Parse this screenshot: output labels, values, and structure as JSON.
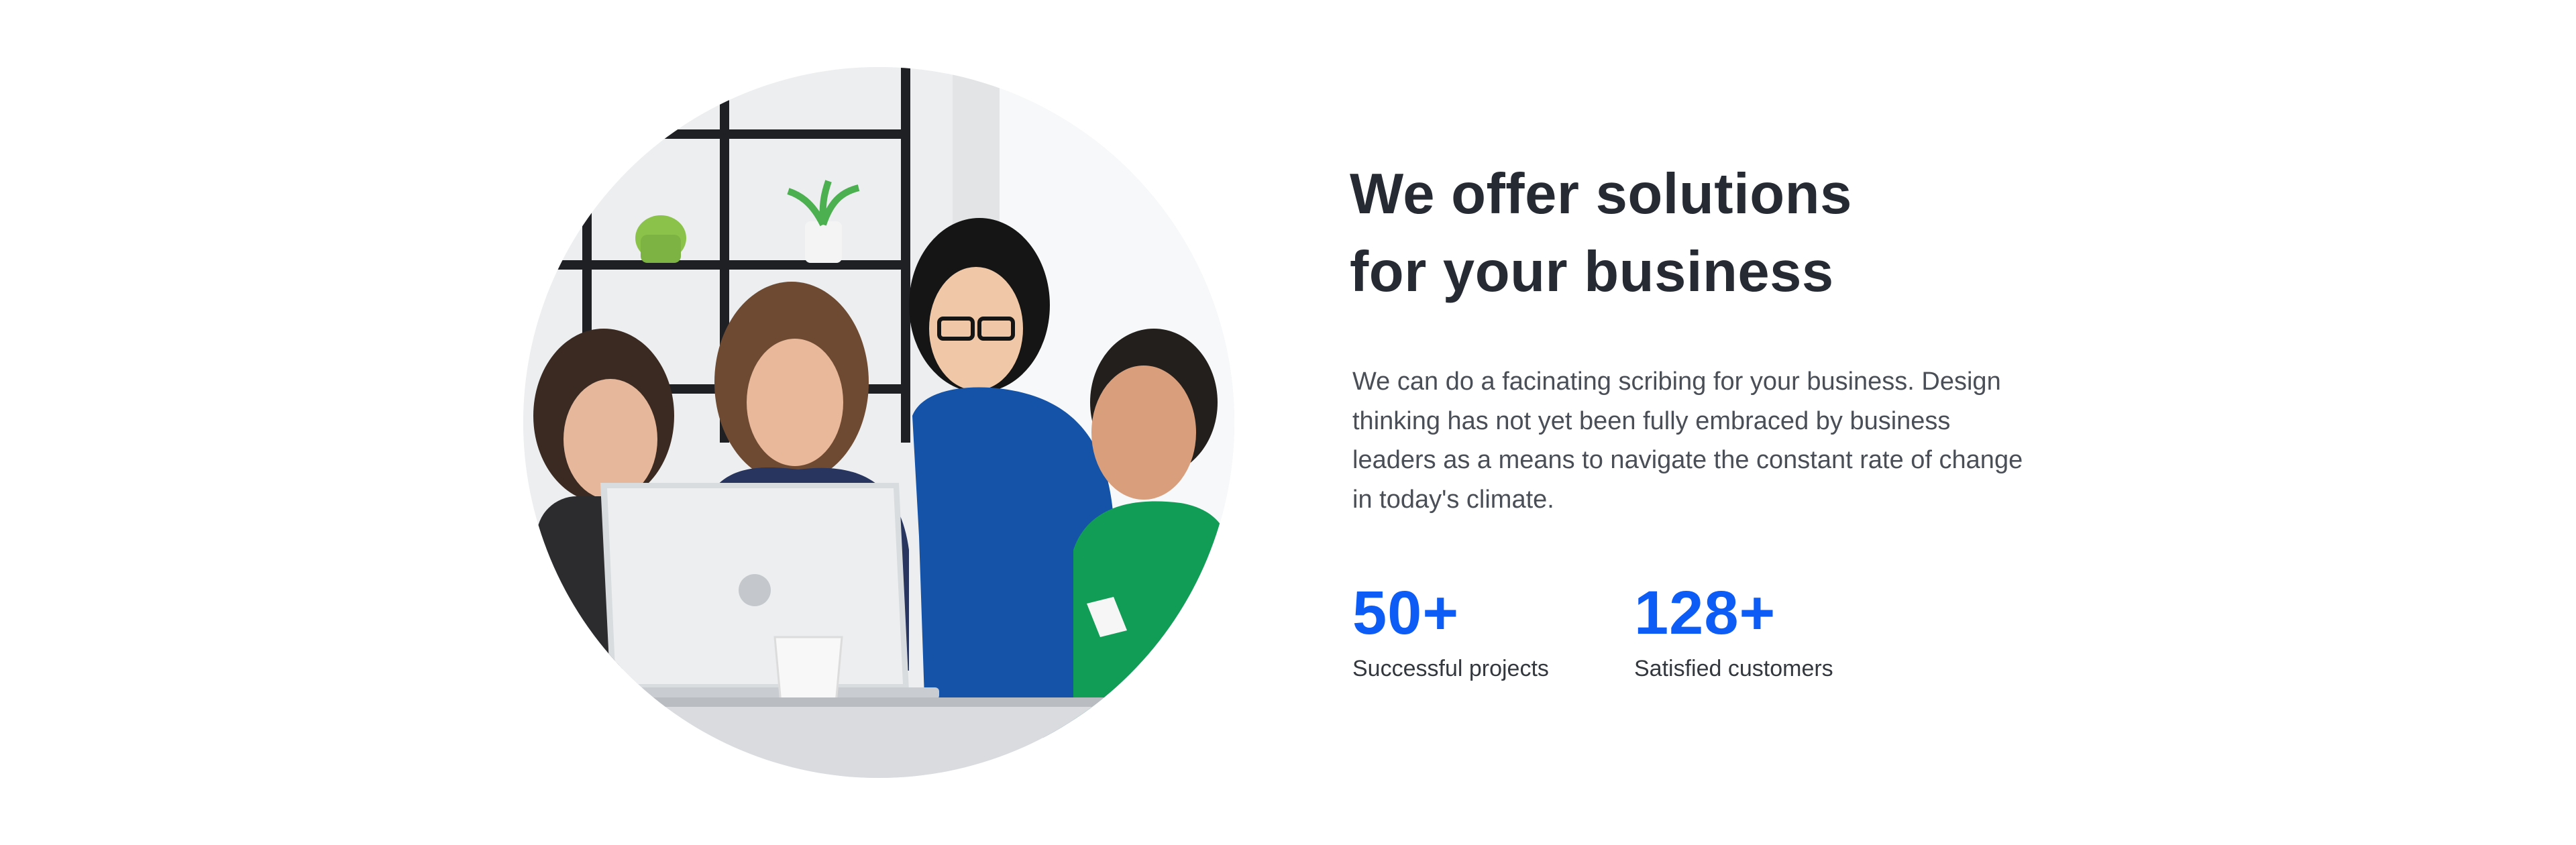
{
  "image": {
    "alt": "Team working together at a laptop",
    "icon": "team-photo"
  },
  "heading": {
    "line1": "We offer solutions",
    "line2": "for your business"
  },
  "description": "We can do a facinating scribing for your business. Design thinking has not yet been fully embraced by business leaders as a means to navigate the constant rate of change in today's climate.",
  "stats": [
    {
      "value": "50+",
      "label": "Successful projects"
    },
    {
      "value": "128+",
      "label": "Satisfied customers"
    }
  ],
  "colors": {
    "accent": "#0d5cf5",
    "heading": "#262a33",
    "body": "#4a4f57",
    "background": "#ffffff"
  }
}
